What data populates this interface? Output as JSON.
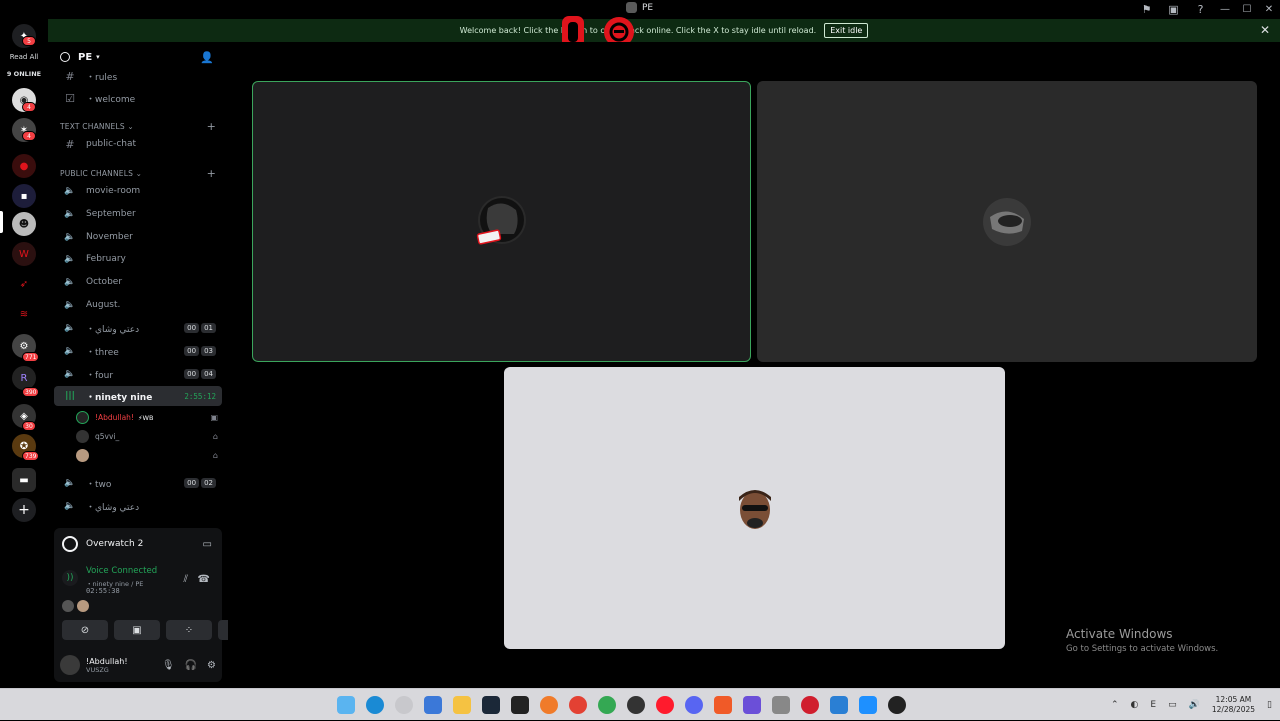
{
  "titlebar": {
    "server_name": "PE",
    "icons": [
      "flag-icon",
      "inbox-icon",
      "help-icon"
    ],
    "window_controls": [
      "minimize-icon",
      "maximize-icon",
      "close-icon"
    ]
  },
  "notice": {
    "message": "Welcome back! Click the button to come back online. Click the X to stay idle until reload.",
    "exit_label": "Exit idle",
    "overlay_badges": [
      "0",
      "6"
    ]
  },
  "rail": {
    "home_badge": "5",
    "read_all": "Read All",
    "online": "9 ONLINE",
    "badges": [
      "4",
      "4",
      "771",
      "390",
      "30",
      "739"
    ]
  },
  "server": {
    "name": "PE"
  },
  "channels": {
    "top": [
      {
        "name": "・rules",
        "type": "text"
      },
      {
        "name": "・welcome",
        "type": "rules"
      }
    ],
    "text_category": "TEXT CHANNELS",
    "text": [
      {
        "name": "public-chat"
      }
    ],
    "public_category": "PUBLIC CHANNELS",
    "voice": [
      {
        "name": "movie-room"
      },
      {
        "name": "September"
      },
      {
        "name": "November"
      },
      {
        "name": "February"
      },
      {
        "name": "October"
      },
      {
        "name": "August."
      },
      {
        "name": "・دعتي وشاي",
        "a": "00",
        "b": "01"
      },
      {
        "name": "・three",
        "a": "00",
        "b": "03"
      },
      {
        "name": "・four",
        "a": "00",
        "b": "04"
      }
    ],
    "active": {
      "name": "・ninety nine",
      "timer": "2:55:12"
    },
    "members": [
      {
        "name": "!Abdullah!",
        "tag": "WB",
        "color": "#f23f43"
      },
      {
        "name": "q5vvi_"
      },
      {
        "name": ""
      }
    ],
    "after": [
      {
        "name": "・two",
        "a": "00",
        "b": "02"
      },
      {
        "name": "・دعتي وشاي"
      }
    ]
  },
  "activity": {
    "game": "Overwatch 2"
  },
  "voice": {
    "status": "Voice Connected",
    "location": "・ninety nine / PE",
    "time": "02:55:38",
    "status_color": "#23a559"
  },
  "user": {
    "name": "!Abdullah!",
    "status": "VUSZG"
  },
  "tiles": [
    {
      "bg": "#1e1e1f",
      "speaking": true
    },
    {
      "bg": "#2a2a2a",
      "speaking": false
    },
    {
      "bg": "#dcdce0",
      "speaking": false
    }
  ],
  "watermark": {
    "title": "Activate Windows",
    "subtitle": "Go to Settings to activate Windows."
  },
  "taskbar": {
    "time": "12:05 AM",
    "date": "12/28/2025",
    "tray_letter": "E"
  }
}
